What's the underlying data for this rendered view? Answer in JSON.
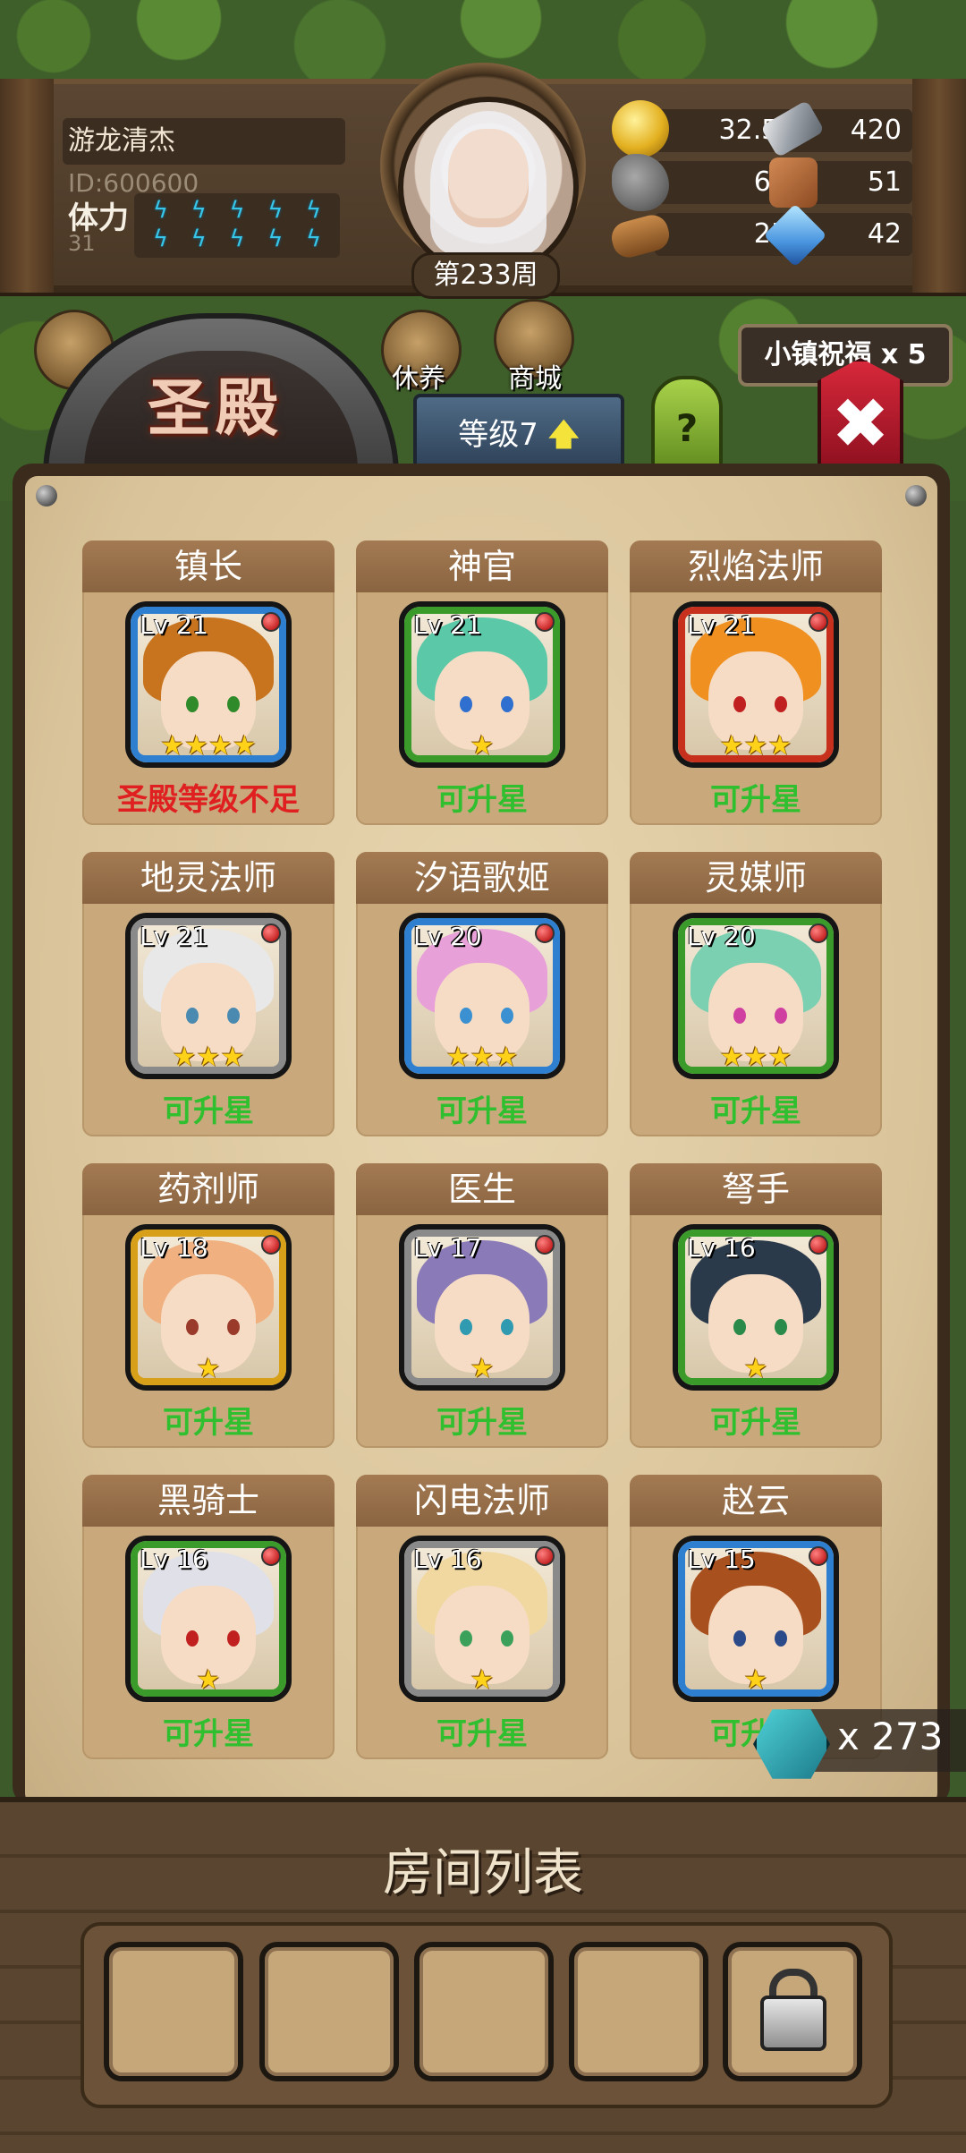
{
  "player": {
    "name": "游龙清杰",
    "id_text": "ID:600600",
    "stamina_label": "体力",
    "stamina_value": "31"
  },
  "week_label": "第233周",
  "resources": {
    "gold": "32.5W",
    "iron": "420",
    "stone": "656",
    "leather": "51",
    "wood": "259",
    "crystal": "42"
  },
  "buildings": {
    "rest": "休养",
    "shop": "商城"
  },
  "temple": {
    "title": "圣殿",
    "level_label": "等级7",
    "level_arrow": "🡅",
    "help": "?",
    "blessing": "小镇祝福 x 5",
    "close": "✖"
  },
  "characters": [
    {
      "name": "镇长",
      "level": "Lv 21",
      "stars": "★★★★",
      "status": "圣殿等级不足",
      "status_color": "#e02020",
      "frame": "#2f7fd0",
      "hair": "#c8741e",
      "eye": "#2f8a2a"
    },
    {
      "name": "神官",
      "level": "Lv 21",
      "stars": "★",
      "status": "可升星",
      "status_color": "#2fbf2f",
      "frame": "#3a9b2a",
      "hair": "#5bc8a8",
      "eye": "#2f6fd0"
    },
    {
      "name": "烈焰法师",
      "level": "Lv 21",
      "stars": "★★★",
      "status": "可升星",
      "status_color": "#2fbf2f",
      "frame": "#c8301e",
      "hair": "#f09020",
      "eye": "#c02020"
    },
    {
      "name": "地灵法师",
      "level": "Lv 21",
      "stars": "★★★",
      "status": "可升星",
      "status_color": "#2fbf2f",
      "frame": "#8a8a8a",
      "hair": "#e8e8e8",
      "eye": "#4a8ab0"
    },
    {
      "name": "汐语歌姬",
      "level": "Lv 20",
      "stars": "★★★",
      "status": "可升星",
      "status_color": "#2fbf2f",
      "frame": "#2f7fd0",
      "hair": "#e8a0d8",
      "eye": "#3a90d0"
    },
    {
      "name": "灵媒师",
      "level": "Lv 20",
      "stars": "★★★",
      "status": "可升星",
      "status_color": "#2fbf2f",
      "frame": "#3a9b2a",
      "hair": "#7ad0b0",
      "eye": "#d040a0"
    },
    {
      "name": "药剂师",
      "level": "Lv 18",
      "stars": "★",
      "status": "可升星",
      "status_color": "#2fbf2f",
      "frame": "#d8a018",
      "hair": "#f0b080",
      "eye": "#9a3a2a"
    },
    {
      "name": "医生",
      "level": "Lv 17",
      "stars": "★",
      "status": "可升星",
      "status_color": "#2fbf2f",
      "frame": "#8a8a8a",
      "hair": "#8a7ab8",
      "eye": "#2f9ab0"
    },
    {
      "name": "弩手",
      "level": "Lv 16",
      "stars": "★",
      "status": "可升星",
      "status_color": "#2fbf2f",
      "frame": "#3a9b2a",
      "hair": "#2a3a4a",
      "eye": "#2a8a4a"
    },
    {
      "name": "黑骑士",
      "level": "Lv 16",
      "stars": "★",
      "status": "可升星",
      "status_color": "#2fbf2f",
      "frame": "#3a9b2a",
      "hair": "#e0e0e8",
      "eye": "#c02020"
    },
    {
      "name": "闪电法师",
      "level": "Lv 16",
      "stars": "★",
      "status": "可升星",
      "status_color": "#2fbf2f",
      "frame": "#8a8a8a",
      "hair": "#f0d8a0",
      "eye": "#3aa05a"
    },
    {
      "name": "赵云",
      "level": "Lv 15",
      "stars": "★",
      "status": "可升星",
      "status_color": "#2fbf2f",
      "frame": "#2f7fd0",
      "hair": "#a8501e",
      "eye": "#2a4a8a"
    }
  ],
  "token": {
    "count": "x 273"
  },
  "room_list": {
    "title": "房间列表"
  }
}
